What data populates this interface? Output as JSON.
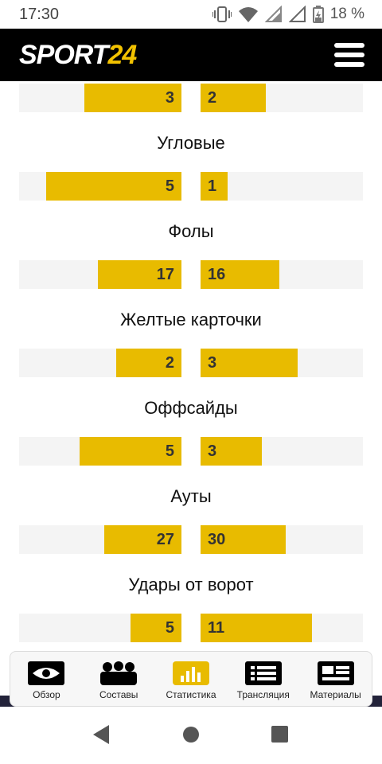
{
  "status_bar": {
    "time": "17:30",
    "battery": "18 %"
  },
  "header": {
    "logo_part1": "SPORT",
    "logo_part2": "24",
    "icons": {
      "menu": "hamburger-icon"
    }
  },
  "colors": {
    "accent": "#e8bb00",
    "header_bg": "#000000",
    "track_bg": "#f4f4f4"
  },
  "stats": [
    {
      "title": "",
      "home": 3,
      "away": 2
    },
    {
      "title": "Угловые",
      "home": 5,
      "away": 1
    },
    {
      "title": "Фолы",
      "home": 17,
      "away": 16
    },
    {
      "title": "Желтые карточки",
      "home": 2,
      "away": 3
    },
    {
      "title": "Оффсайды",
      "home": 5,
      "away": 3
    },
    {
      "title": "Ауты",
      "home": 27,
      "away": 30
    },
    {
      "title": "Удары от ворот",
      "home": 5,
      "away": 11
    }
  ],
  "tabs": [
    {
      "label": "Обзор",
      "icon": "eye-icon",
      "active": false
    },
    {
      "label": "Составы",
      "icon": "team-icon",
      "active": false
    },
    {
      "label": "Статистика",
      "icon": "stats-icon",
      "active": true
    },
    {
      "label": "Трансляция",
      "icon": "list-icon",
      "active": false
    },
    {
      "label": "Материалы",
      "icon": "articles-icon",
      "active": false
    }
  ],
  "system_nav": {
    "icons": [
      "back-icon",
      "home-icon",
      "recents-icon"
    ]
  }
}
